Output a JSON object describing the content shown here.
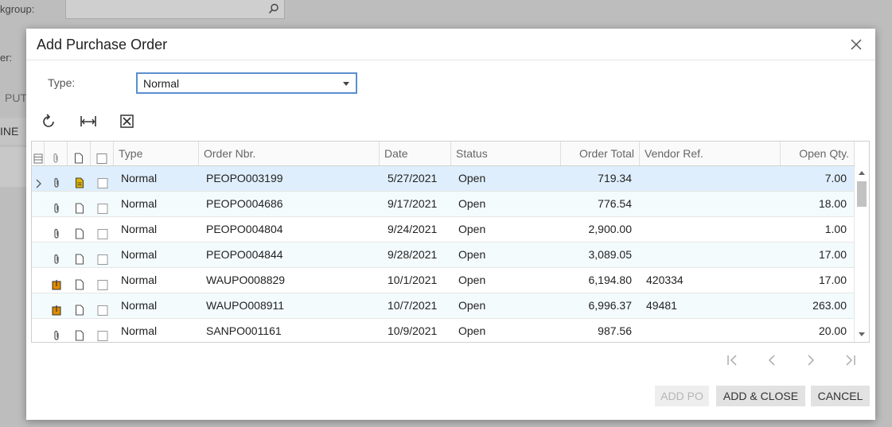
{
  "background": {
    "workgroup_label": "kgroup:",
    "owner_label": "er:",
    "tab_partial": "PUT",
    "row_partial": "INE"
  },
  "dialog": {
    "title": "Add Purchase Order",
    "type_label": "Type:",
    "type_value": "Normal",
    "toolbar": [
      "refresh-icon",
      "fit-columns-icon",
      "export-excel-icon"
    ],
    "columns": {
      "type": "Type",
      "order_nbr": "Order Nbr.",
      "date": "Date",
      "status": "Status",
      "order_total": "Order Total",
      "vendor_ref": "Vendor Ref.",
      "open_qty": "Open Qty."
    },
    "rows": [
      {
        "files": "paperclip-icon",
        "note": "note-filled-icon",
        "type": "Normal",
        "order_nbr": "PEOPO003199",
        "date": "5/27/2021",
        "status": "Open",
        "order_total": "719.34",
        "vendor_ref": "",
        "open_qty": "7.00"
      },
      {
        "files": "paperclip-icon",
        "note": "note-icon",
        "type": "Normal",
        "order_nbr": "PEOPO004686",
        "date": "9/17/2021",
        "status": "Open",
        "order_total": "776.54",
        "vendor_ref": "",
        "open_qty": "18.00"
      },
      {
        "files": "paperclip-icon",
        "note": "note-icon",
        "type": "Normal",
        "order_nbr": "PEOPO004804",
        "date": "9/24/2021",
        "status": "Open",
        "order_total": "2,900.00",
        "vendor_ref": "",
        "open_qty": "1.00"
      },
      {
        "files": "paperclip-icon",
        "note": "note-icon",
        "type": "Normal",
        "order_nbr": "PEOPO004844",
        "date": "9/28/2021",
        "status": "Open",
        "order_total": "3,089.05",
        "vendor_ref": "",
        "open_qty": "17.00"
      },
      {
        "files": "attachment-filled-icon",
        "note": "note-icon",
        "type": "Normal",
        "order_nbr": "WAUPO008829",
        "date": "10/1/2021",
        "status": "Open",
        "order_total": "6,194.80",
        "vendor_ref": "420334",
        "open_qty": "17.00"
      },
      {
        "files": "attachment-filled-icon",
        "note": "note-icon",
        "type": "Normal",
        "order_nbr": "WAUPO008911",
        "date": "10/7/2021",
        "status": "Open",
        "order_total": "6,996.37",
        "vendor_ref": "49481",
        "open_qty": "263.00"
      },
      {
        "files": "paperclip-icon",
        "note": "note-icon",
        "type": "Normal",
        "order_nbr": "SANPO001161",
        "date": "10/9/2021",
        "status": "Open",
        "order_total": "987.56",
        "vendor_ref": "",
        "open_qty": "20.00"
      }
    ],
    "buttons": {
      "add_po": "ADD PO",
      "add_close": "ADD & CLOSE",
      "cancel": "CANCEL"
    }
  },
  "colors": {
    "selected_row": "#dfeefc",
    "focus_border": "#5a8fd0",
    "note_filled": "#e0b400",
    "attachment_filled": "#e08a00"
  }
}
